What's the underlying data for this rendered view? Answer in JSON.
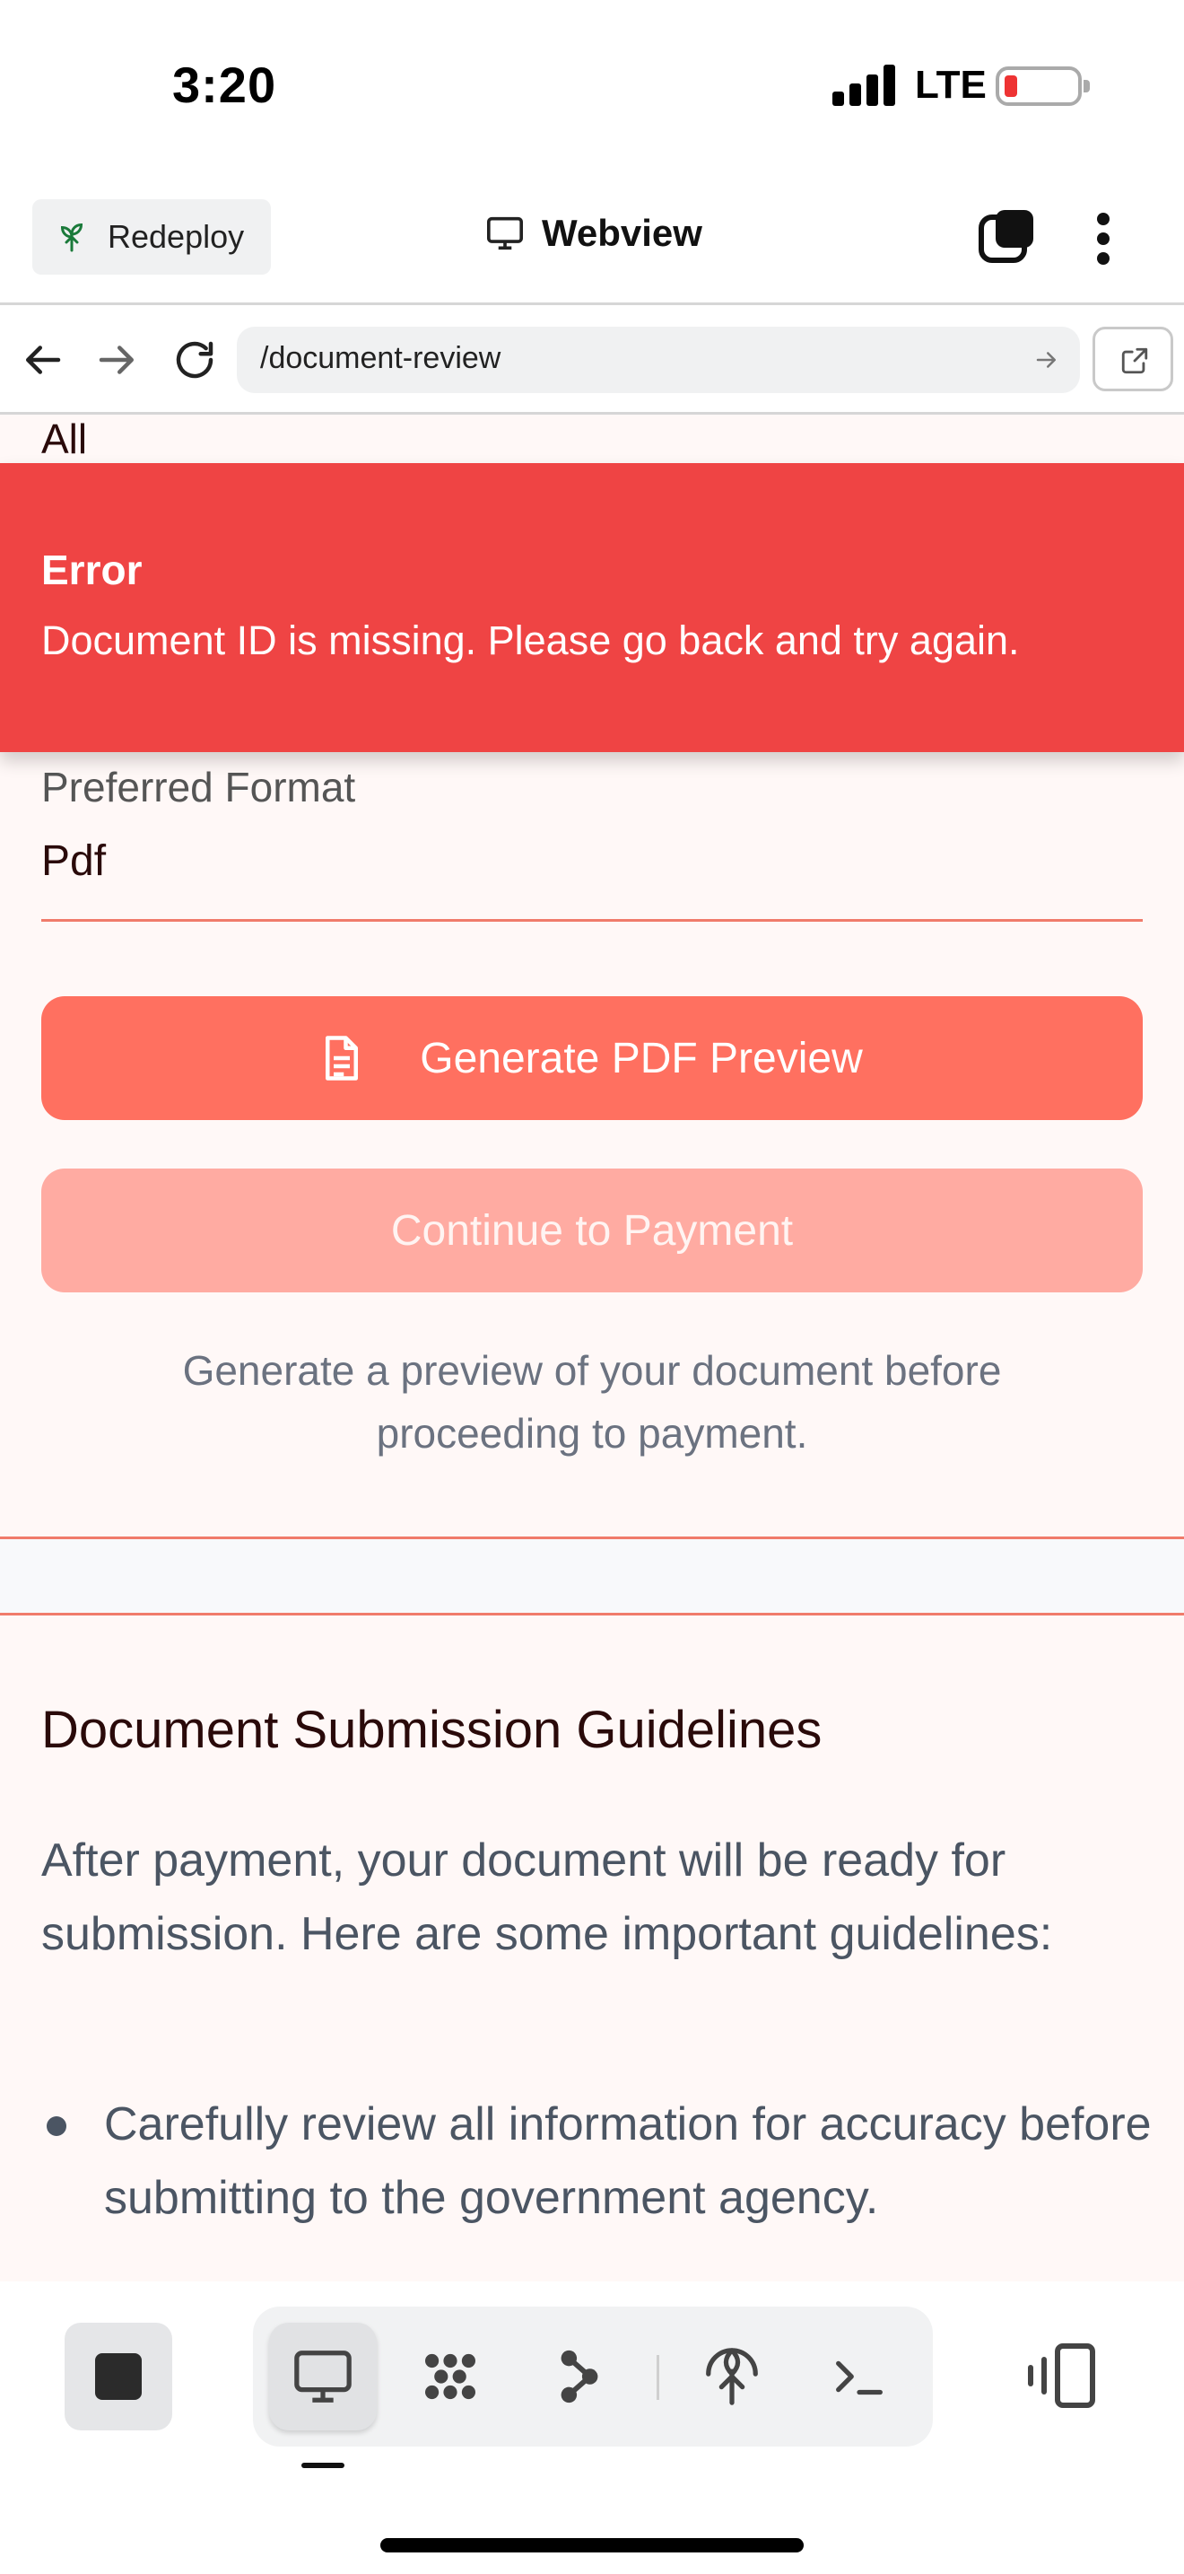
{
  "status_bar": {
    "time": "3:20",
    "network": "LTE",
    "battery_level": 0.1,
    "battery_color": "#e33333"
  },
  "app_bar": {
    "redeploy_label": "Redeploy",
    "title": "Webview",
    "icons": [
      "sprout-icon",
      "monitor-icon",
      "tabs-icon",
      "more-vertical-icon"
    ]
  },
  "url_bar": {
    "url": "/document-review",
    "icons": [
      "back-arrow-icon",
      "forward-arrow-icon",
      "reload-icon",
      "go-arrow-icon",
      "external-link-icon"
    ]
  },
  "page": {
    "top_text": "All",
    "error": {
      "title": "Error",
      "message": "Document ID is missing. Please go back and try again.",
      "color": "#ef4444"
    },
    "format": {
      "label": "Preferred Format",
      "value": "Pdf"
    },
    "generate_button": "Generate PDF Preview",
    "payment_button": "Continue to Payment",
    "helper_text": "Generate a preview of your document before proceeding to payment.",
    "guidelines": {
      "title": "Document Submission Guidelines",
      "intro": "After payment, your document will be ready for submission. Here are some important guidelines:",
      "items": [
        "Carefully review all information for accuracy before submitting to the government agency."
      ]
    },
    "accent_color": "#ff7060"
  },
  "bottom_bar": {
    "tools": [
      "monitor-icon",
      "grid-dots-icon",
      "branch-icon",
      "sprout-icon",
      "terminal-icon"
    ],
    "active_tool": "monitor-icon"
  }
}
